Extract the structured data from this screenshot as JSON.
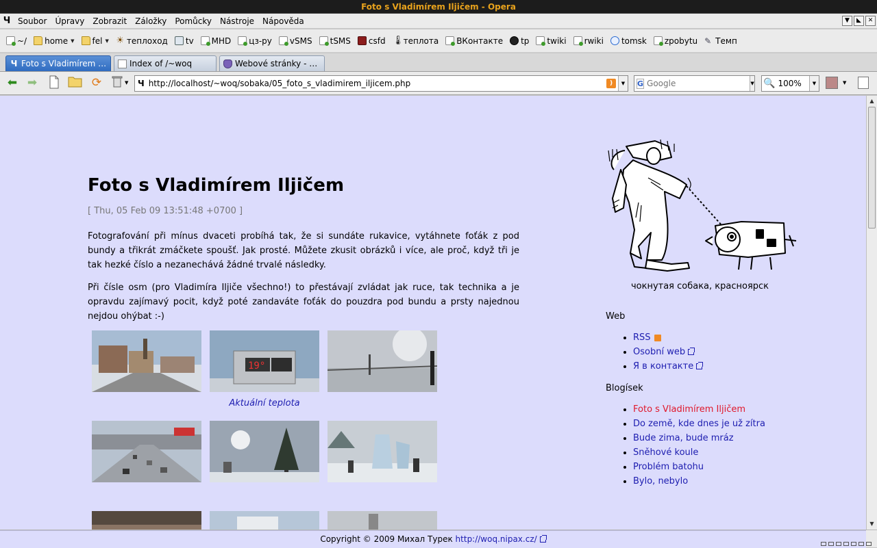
{
  "window": {
    "title": "Foto s Vladimírem Iljičem - Opera"
  },
  "menu": [
    {
      "label": "Soubor"
    },
    {
      "label": "Úpravy"
    },
    {
      "label": "Zobrazit"
    },
    {
      "label": "Záložky"
    },
    {
      "label": "Pomůcky"
    },
    {
      "label": "Nástroje"
    },
    {
      "label": "Nápověda"
    }
  ],
  "bookmarks": [
    {
      "label": "~/",
      "icon": "page-icon"
    },
    {
      "label": "home",
      "icon": "folder-icon"
    },
    {
      "label": "fel",
      "icon": "folder-icon"
    },
    {
      "label": "теплоход",
      "icon": "sun-icon"
    },
    {
      "label": "tv",
      "icon": "tv-icon"
    },
    {
      "label": "MHD",
      "icon": "page-icon"
    },
    {
      "label": "цз-ру",
      "icon": "page-icon"
    },
    {
      "label": "vSMS",
      "icon": "page-icon"
    },
    {
      "label": "tSMS",
      "icon": "page-icon"
    },
    {
      "label": "csfd",
      "icon": "film-icon"
    },
    {
      "label": "теплота",
      "icon": "thermometer-icon"
    },
    {
      "label": "ВКонтакте",
      "icon": "page-icon"
    },
    {
      "label": "tp",
      "icon": "tp-icon"
    },
    {
      "label": "twiki",
      "icon": "page-icon"
    },
    {
      "label": "rwiki",
      "icon": "page-icon"
    },
    {
      "label": "tomsk",
      "icon": "tomsk-icon"
    },
    {
      "label": "zpobytu",
      "icon": "page-icon"
    },
    {
      "label": "Темп",
      "icon": "pen-icon"
    }
  ],
  "tabs": [
    {
      "label": "Foto s Vladimírem Iljič...",
      "active": true
    },
    {
      "label": "Index of /~woq",
      "active": false
    },
    {
      "label": "Webové stránky - Mich...",
      "active": false
    }
  ],
  "address": {
    "url": "http://localhost/~woq/sobaka/05_foto_s_vladimirem_iljicem.php"
  },
  "search": {
    "placeholder": "Google"
  },
  "zoom": {
    "value": "100%"
  },
  "article": {
    "title": "Foto s Vladimírem Iljičem",
    "date": "[ Thu, 05 Feb 09 13:51:48 +0700 ]",
    "paragraphs": [
      "Fotografování při mínus dvaceti probíhá tak, že si sundáte rukavice, vytáhnete foťák z pod bundy a třikrát zmáčkete spoušť. Jak prosté. Můžete zkusit obrázků i více, ale proč, když tři je tak hezké číslo a nezanechává žádné trvalé následky.",
      "Při čísle osm (pro Vladimíra Iljiče všechno!) to přestávají zvládat jak ruce, tak technika a je opravdu zajímavý pocit, když poté zandaváte foťák do pouzdra pod bundu a prsty najednou nejdou ohýbat :-)"
    ],
    "caption": "Aktuální teplota"
  },
  "sidebar": {
    "tagline": "чокнутая собака, красноярск",
    "web_heading": "Web",
    "web_links": [
      "RSS",
      "Osobní web",
      "Я в контакте"
    ],
    "blog_heading": "Blogísek",
    "blog_links": [
      "Foto s Vladimírem Iljičem",
      "Do země, kde dnes je už zítra",
      "Bude zima, bude mráz",
      "Sněhové koule",
      "Problém batohu",
      "Bylo, nebylo"
    ]
  },
  "footer": {
    "text": "Copyright © 2009 Михал Турек",
    "link": "http://woq.nipax.cz/"
  },
  "colors": {
    "page_bg": "#dcdcfc",
    "link": "#1d1db0",
    "current_link": "#e0182b",
    "title_text": "#e8a21c"
  }
}
